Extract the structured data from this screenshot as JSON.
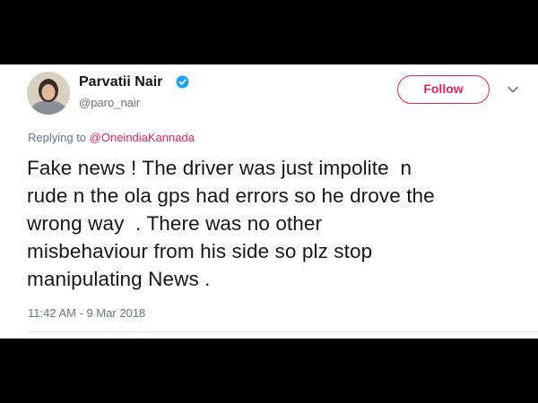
{
  "author": {
    "display_name": "Parvatii Nair",
    "handle": "@paro_nair"
  },
  "actions": {
    "follow_label": "Follow"
  },
  "reply": {
    "prefix": "Replying to ",
    "mention": "@OneindiaKannada"
  },
  "tweet": {
    "text": "Fake news ! The driver was just impolite  n\nrude n the ola gps had errors so he drove the\nwrong way  . There was no other\nmisbehaviour from his side so plz stop\nmanipulating News .",
    "timestamp": "11:42 AM - 9 Mar 2018"
  },
  "icons": {
    "verified": "verified-badge-icon",
    "caret": "chevron-down-icon"
  },
  "colors": {
    "background": "#000000",
    "card": "#ffffff",
    "accent": "#e0245e",
    "verified": "#1da1f2",
    "text_primary": "#14171a",
    "text_secondary": "#657786"
  }
}
